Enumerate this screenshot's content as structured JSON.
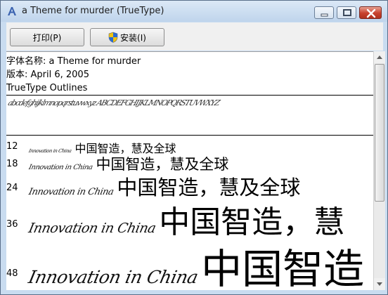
{
  "window": {
    "title": "a Theme for murder (TrueType)"
  },
  "toolbar": {
    "print_label": "打印(P)",
    "install_label": "安装(I)"
  },
  "font_info": {
    "name_line": "字体名称: a Theme for murder",
    "version_line": "版本: April 6, 2005",
    "outline_line": "TrueType Outlines"
  },
  "charset_sample": "abcdefghijklmnopqrstuvwxyz ABCDEFGHIJKLMNOPQRSTUVWXYZ",
  "samples": [
    {
      "size": "12",
      "latin": "Innovation in China",
      "cjk": "中国智造，慧及全球"
    },
    {
      "size": "18",
      "latin": "Innovation in China",
      "cjk": "中国智造，慧及全球"
    },
    {
      "size": "24",
      "latin": "Innovation in China",
      "cjk": "中国智造，慧及全球"
    },
    {
      "size": "36",
      "latin": "Innovation in China",
      "cjk": "中国智造，慧"
    },
    {
      "size": "48",
      "latin": "Innovation in China",
      "cjk": "中国智造"
    }
  ]
}
